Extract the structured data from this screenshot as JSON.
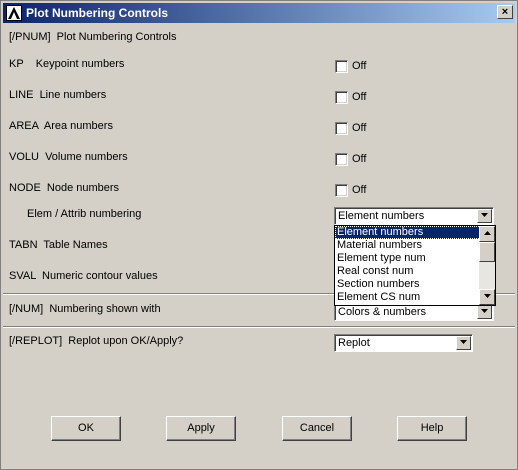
{
  "window": {
    "title": "Plot Numbering Controls"
  },
  "header": {
    "text": "[/PNUM]  Plot Numbering Controls"
  },
  "rows": [
    {
      "label": "KP    Keypoint numbers",
      "check_label": "Off"
    },
    {
      "label": "LINE  Line numbers",
      "check_label": "Off"
    },
    {
      "label": "AREA  Area numbers",
      "check_label": "Off"
    },
    {
      "label": "VOLU  Volume numbers",
      "check_label": "Off"
    },
    {
      "label": "NODE  Node numbers",
      "check_label": "Off"
    }
  ],
  "elem": {
    "label": "Elem / Attrib numbering",
    "value": "Element numbers",
    "options": [
      "Element numbers",
      "Material numbers",
      "Element type num",
      "Real const num",
      "Section numbers",
      "Element CS num"
    ]
  },
  "tabn": {
    "label": "TABN  Table Names"
  },
  "sval": {
    "label": "SVAL  Numeric contour values"
  },
  "num": {
    "label": "[/NUM]  Numbering shown with",
    "value": "Colors & numbers"
  },
  "replot": {
    "label": "[/REPLOT]  Replot upon OK/Apply?",
    "value": "Replot"
  },
  "buttons": {
    "ok": "OK",
    "apply": "Apply",
    "cancel": "Cancel",
    "help": "Help"
  },
  "close_glyph": "×"
}
